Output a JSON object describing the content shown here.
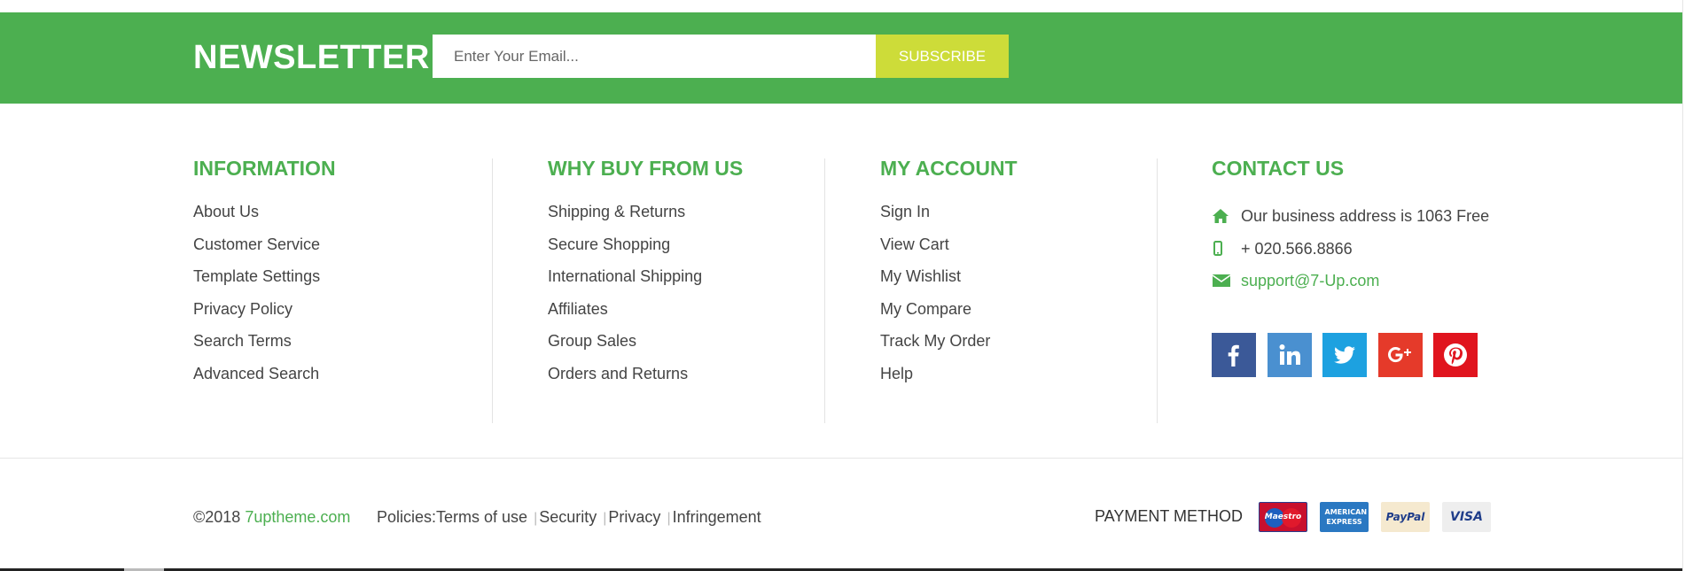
{
  "newsletter": {
    "title": "NEWSLETTER",
    "email_placeholder": "Enter Your Email...",
    "subscribe_label": "SUBSCRIBE"
  },
  "columns": {
    "information": {
      "title": "INFORMATION",
      "links": [
        "About Us",
        "Customer Service",
        "Template Settings",
        "Privacy Policy",
        "Search Terms",
        "Advanced Search"
      ]
    },
    "why_buy": {
      "title": "WHY BUY FROM US",
      "links": [
        "Shipping & Returns",
        "Secure Shopping",
        "International Shipping",
        "Affiliates",
        "Group Sales",
        "Orders and Returns"
      ]
    },
    "my_account": {
      "title": "MY ACCOUNT",
      "links": [
        "Sign In",
        "View Cart",
        "My Wishlist",
        "My Compare",
        "Track My Order",
        "Help"
      ]
    },
    "contact": {
      "title": "CONTACT US",
      "address": "Our business address is 1063 Free",
      "phone": "+ 020.566.8866",
      "email": "support@7-Up.com"
    }
  },
  "socials": [
    {
      "icon": "facebook-icon",
      "color": "#3b5998"
    },
    {
      "icon": "linkedin-icon",
      "color": "#4a90d0"
    },
    {
      "icon": "twitter-icon",
      "color": "#1da1e0"
    },
    {
      "icon": "google-plus-icon",
      "color": "#e53a2a"
    },
    {
      "icon": "pinterest-icon",
      "color": "#e0141e"
    }
  ],
  "footer": {
    "copyright_prefix": "©2018",
    "copyright_link": "7uptheme.com",
    "policies_label": "Policies:",
    "policy_links": [
      "Terms of use",
      "Security",
      "Privacy",
      "Infringement"
    ],
    "payment_label": "PAYMENT METHOD",
    "payment_cards": [
      "Maestro",
      "AMERICAN EXPRESS",
      "PayPal",
      "VISA"
    ]
  },
  "colors": {
    "accent": "#4caf50",
    "subscribe": "#cddc39"
  }
}
